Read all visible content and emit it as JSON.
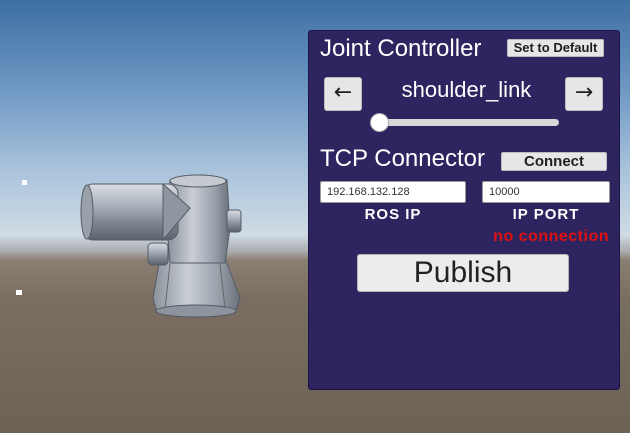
{
  "scene": {
    "description_icon": "robot-arm-model"
  },
  "panel": {
    "joint_controller": {
      "title": "Joint Controller",
      "set_default_label": "Set to Default",
      "prev_arrow": "←",
      "next_arrow": "→",
      "joint_name": "shoulder_link",
      "slider_value_fraction": 0.0
    },
    "tcp_connector": {
      "title": "TCP Connector",
      "connect_label": "Connect",
      "ros_ip_value": "192.168.132.128",
      "ros_ip_label": "ROS IP",
      "ip_port_value": "10000",
      "ip_port_label": "IP PORT",
      "status_text": "no connection",
      "status_color": "#e01010"
    },
    "publish_label": "Publish",
    "panel_color": "#2e2560"
  }
}
